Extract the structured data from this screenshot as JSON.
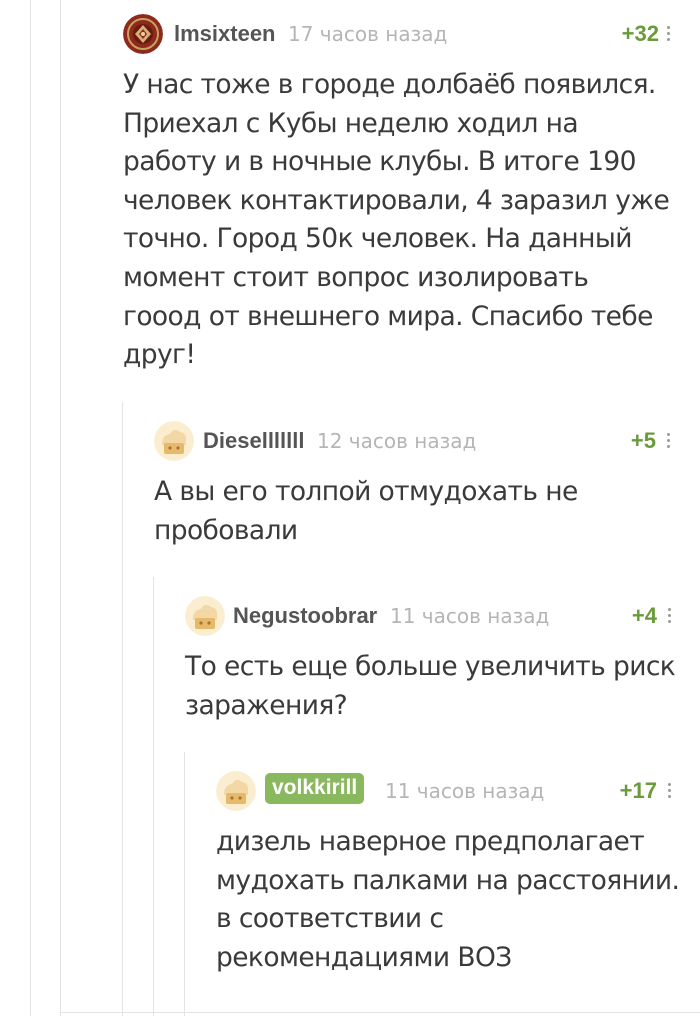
{
  "accent_colors": {
    "rating_positive": "#6a9b3a",
    "author_badge": "#8ab85e",
    "thread_line": "#e3e3e3"
  },
  "comments": [
    {
      "username": "lmsixteen",
      "time": "17 часов назад",
      "rating": "+32",
      "avatar_icon": "ornament-avatar-icon",
      "text_lines": [
        "У нас тоже в городе долбаёб появился.",
        "Приехал с Кубы неделю ходил на",
        "работу и в ночные клубы. В итоге 190",
        "человек контактировали, 4 заразил уже",
        "точно. Город 50к человек. На данный",
        "момент стоит вопрос изолировать",
        "гооод от внешнего мира. Спасибо тебе",
        "друг!"
      ]
    },
    {
      "username": "Dieselllllll",
      "time": "12 часов назад",
      "rating": "+5",
      "avatar_icon": "default-avatar-icon",
      "text_lines": [
        "А вы его толпой отмудохать не",
        "пробовали"
      ]
    },
    {
      "username": "Negustoobrar",
      "time": "11 часов назад",
      "rating": "+4",
      "avatar_icon": "default-avatar-icon",
      "text_lines": [
        "То есть еще больше увеличить риск",
        "заражения?"
      ]
    },
    {
      "username": "volkkirill",
      "time": "11 часов назад",
      "rating": "+17",
      "avatar_icon": "default-avatar-icon",
      "is_author_badge": true,
      "text_lines": [
        "дизель наверное предполагает",
        "мудохать палками на расстоянии.",
        "в соответствии с",
        "рекомендациями ВОЗ"
      ]
    }
  ]
}
